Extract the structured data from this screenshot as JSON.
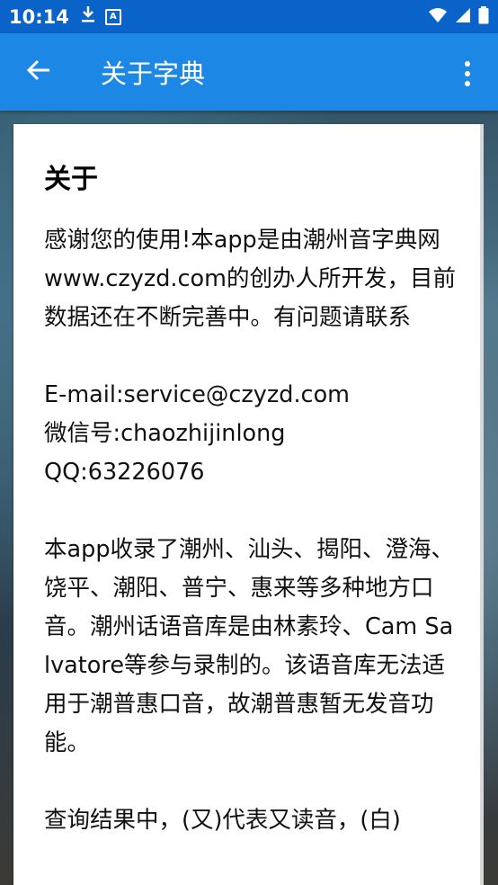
{
  "status_bar": {
    "time": "10:14"
  },
  "app_bar": {
    "title": "关于字典"
  },
  "card": {
    "heading": "关于",
    "body": "感谢您的使用!本app是由潮州音字典网www.czyzd.com的创办人所开发，目前数据还在不断完善中。有问题请联系\n\nE-mail:service@czyzd.com\n微信号:chaozhijinlong\nQQ:63226076\n\n本app收录了潮州、汕头、揭阳、澄海、饶平、潮阳、普宁、惠来等多种地方口音。潮州话语音库是由林素玲、Cam Salvatore等参与录制的。该语音库无法适用于潮普惠口音，故潮普惠暂无发音功能。\n\n查询结果中，(又)代表又读音，(白)"
  }
}
